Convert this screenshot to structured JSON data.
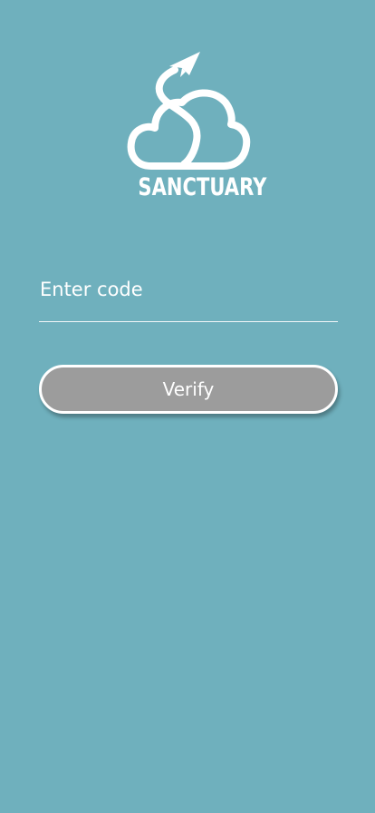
{
  "brand": {
    "name": "SANCTUARY",
    "logo_icon": "cloud-paper-plane-icon"
  },
  "code": {
    "placeholder": "Enter code",
    "value": ""
  },
  "verify": {
    "label": "Verify"
  },
  "colors": {
    "background": "#6fb0bd",
    "button": "#9c9c9c",
    "foreground": "#ffffff"
  }
}
